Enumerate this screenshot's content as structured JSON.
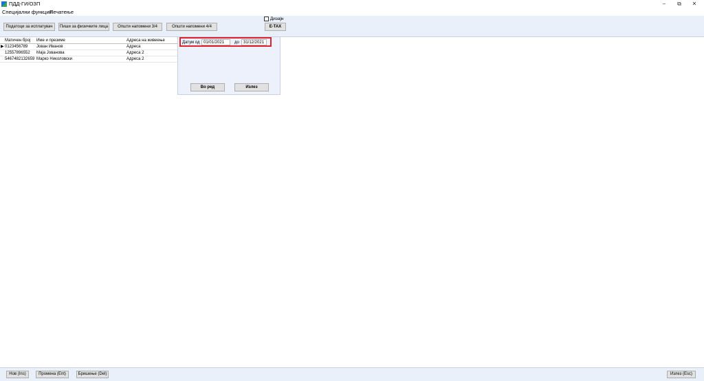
{
  "window": {
    "title": "ПДД-ГИ/ОЗП",
    "controls": {
      "minimize": "–",
      "restore": "⧉",
      "close": "✕"
    }
  },
  "menu": [
    "Специјални функции",
    "Печатење"
  ],
  "toolbar": {
    "buttons": [
      "Податоци за исплатувач",
      "Пиши за физичките лица",
      "Општи напомени 3/4",
      "Општи напомени 4/4"
    ],
    "checkbox_label": "Дизајн",
    "etax_label": "E-TAX"
  },
  "grid": {
    "columns": [
      "Матичен број",
      "Име и презиме",
      "Адреса на живеење"
    ],
    "rows": [
      [
        "0123456789",
        "Јован Иванов",
        "Адреса"
      ],
      [
        "12557896552",
        "Маја Јованова",
        "Адреса 2"
      ],
      [
        "5467482132659",
        "Марко Николовски",
        "Адреса 2"
      ]
    ],
    "current_row_marker": "▶"
  },
  "date_filter": {
    "from_label": "Датум од",
    "from_value": "01/01/2021",
    "to_label": "до",
    "to_value": "31/12/2021",
    "ok_label": "Во ред",
    "exit_label": "Излез",
    "highlight_color": "#e0202a"
  },
  "bottom": {
    "new_label": "Нов (Ins)",
    "edit_label": "Промена (Ent)",
    "delete_label": "Бришење (Del)",
    "exit_label": "Излез (Esc)"
  }
}
